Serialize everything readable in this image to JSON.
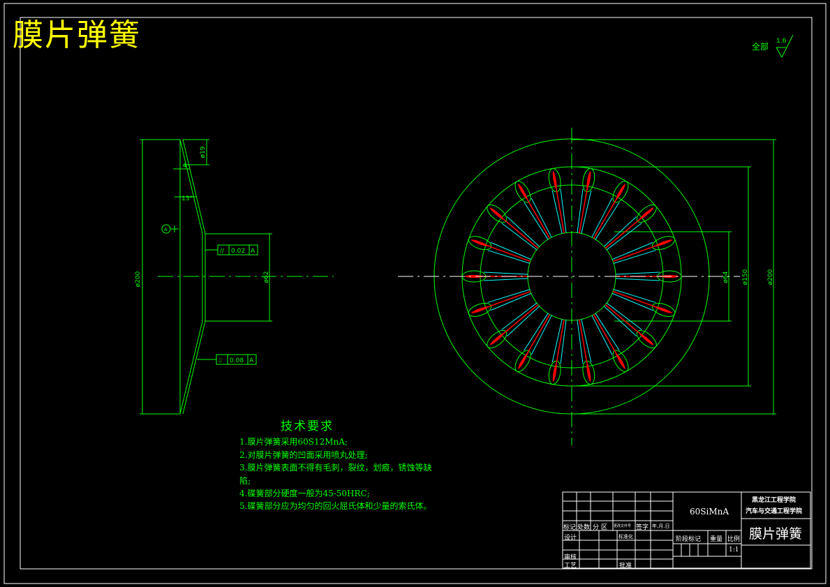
{
  "drawing": {
    "title": "膜片弹簧",
    "roughness": {
      "label": "全部",
      "value": "1.6"
    }
  },
  "side_view": {
    "dims": {
      "d200": "ø200",
      "d62": "ø62",
      "d19": "ø19",
      "t4": "4",
      "angle": "13°",
      "datum": "A"
    },
    "tolerances": [
      {
        "symbol": "//",
        "value": "0.02",
        "datum": "A"
      },
      {
        "symbol": "⌰",
        "value": "0.08",
        "datum": "A"
      }
    ]
  },
  "front_view": {
    "dims": {
      "d200": "ø200",
      "d150": "ø150",
      "d64": "ø64"
    }
  },
  "technical_requirements": {
    "title": "技术要求",
    "items": [
      "1.膜片弹簧采用60S12MnA;",
      "2.对膜片弹簧的凹面采用喷丸处理;",
      "3.膜片弹簧表面不得有毛刺，裂纹，划痕，锈蚀等缺",
      "陷;",
      "4.碟簧部分硬度一般为45-50HRC;",
      "5.碟簧部分应为均匀的回火屈氏体和少量的索氏体。"
    ]
  },
  "title_block": {
    "material": "60SiMnA",
    "school_line1": "黑龙江工程学院",
    "school_line2": "汽车与交通工程学院",
    "part_name": "膜片弹簧",
    "header_labels": [
      "标记",
      "处数",
      "分 区",
      "更改文件号",
      "签字",
      "年.月.日"
    ],
    "design": "设计",
    "standardization": "标准化",
    "review": "审核",
    "process": "工艺",
    "approve": "批准",
    "stage_mark": "阶段标记",
    "weight": "重量",
    "scale_label": "比例",
    "scale": "1:1"
  },
  "colors": {
    "outline": "#00ff00",
    "title_text": "#ffff00",
    "frame": "#ffffff",
    "slot_red": "#ff0000",
    "slot_cyan": "#00ffff"
  }
}
